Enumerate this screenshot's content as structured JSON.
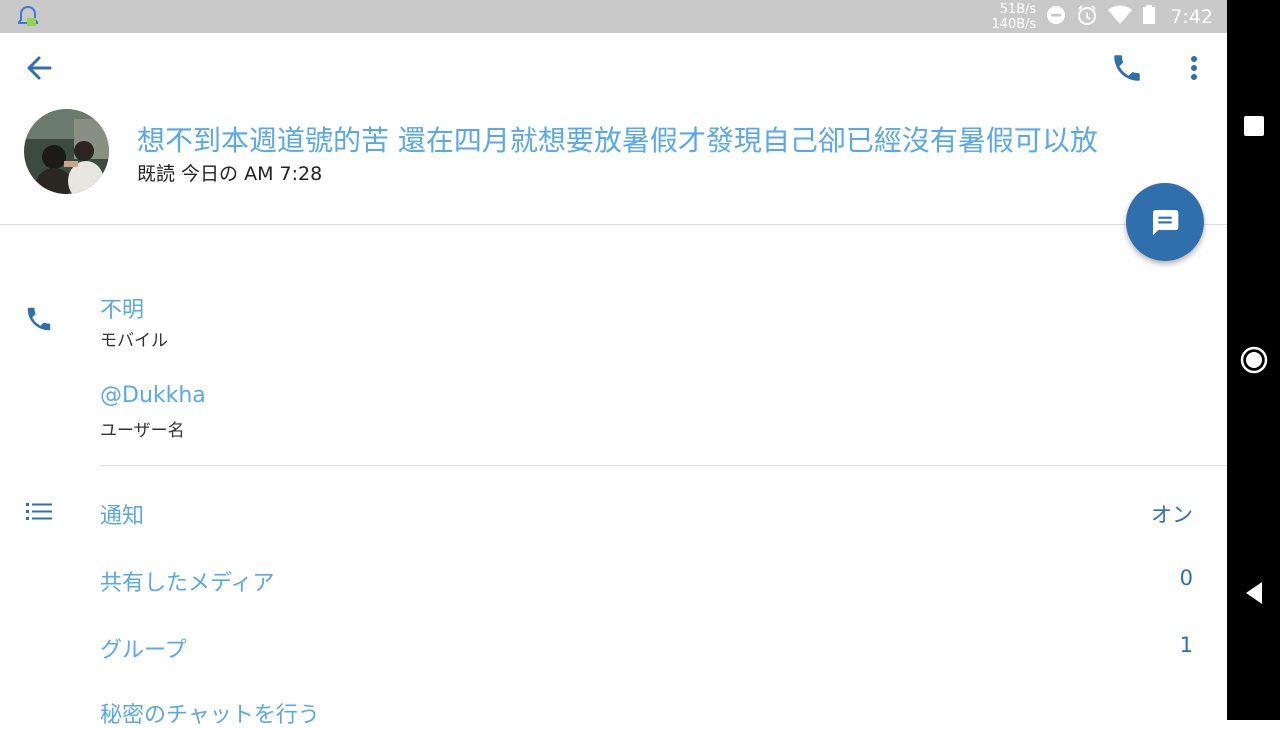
{
  "status_bar": {
    "net_up": "51B/s",
    "net_down": "140B/s",
    "time": "7:42"
  },
  "header": {
    "title": "想不到本週道號的苦 還在四月就想要放暑假才發現自己卻已經沒有暑假可以放",
    "status": "既読 今日の AM 7:28"
  },
  "info": {
    "phone_value": "不明",
    "phone_label": "モバイル",
    "username_value": "@Dukkha",
    "username_label": "ユーザー名"
  },
  "settings": {
    "notifications_label": "通知",
    "notifications_value": "オン",
    "shared_media_label": "共有したメディア",
    "shared_media_value": "0",
    "groups_label": "グループ",
    "groups_value": "1",
    "secret_chat_label": "秘密のチャットを行う"
  },
  "colors": {
    "accent": "#2f6fae",
    "link": "#5aa8e6",
    "status_bar": "#c9c9c9"
  }
}
